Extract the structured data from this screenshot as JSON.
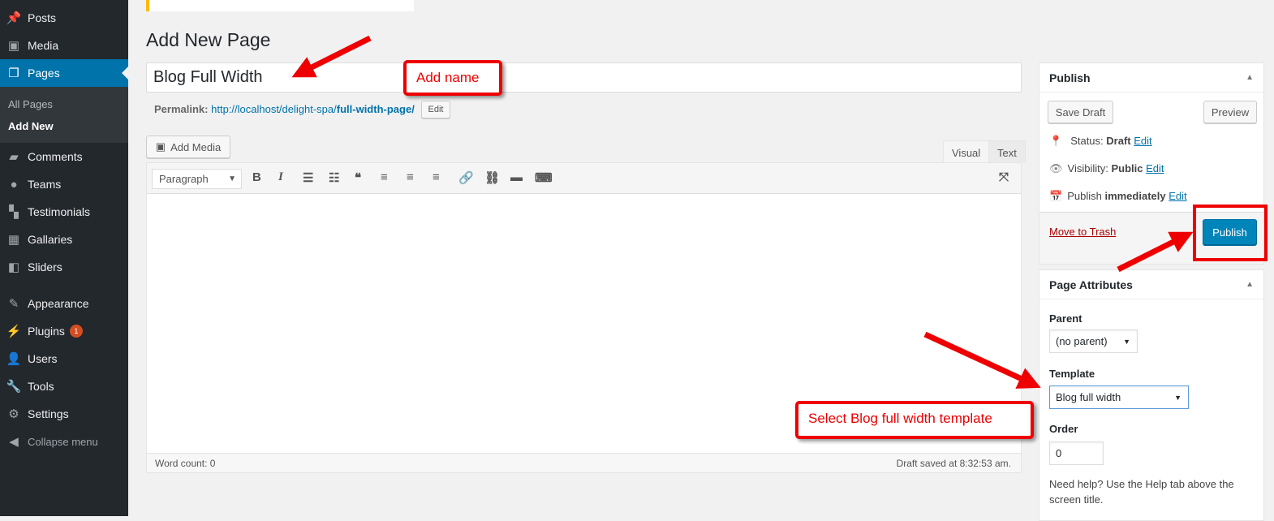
{
  "sidebar": {
    "items": [
      {
        "label": "Posts",
        "icon": "pin-icon"
      },
      {
        "label": "Media",
        "icon": "media-icon"
      },
      {
        "label": "Pages",
        "icon": "pages-icon",
        "active": true
      },
      {
        "label": "Comments",
        "icon": "comment-icon"
      },
      {
        "label": "Teams",
        "icon": "groups-icon"
      },
      {
        "label": "Testimonials",
        "icon": "testimonial-icon"
      },
      {
        "label": "Gallaries",
        "icon": "gallery-icon"
      },
      {
        "label": "Sliders",
        "icon": "slides-icon"
      },
      {
        "label": "Appearance",
        "icon": "brush-icon"
      },
      {
        "label": "Plugins",
        "icon": "plugin-icon",
        "badge": "1"
      },
      {
        "label": "Users",
        "icon": "user-icon"
      },
      {
        "label": "Tools",
        "icon": "wrench-icon"
      },
      {
        "label": "Settings",
        "icon": "settings-icon"
      },
      {
        "label": "Collapse menu",
        "icon": "collapse-icon"
      }
    ],
    "submenu": [
      "All Pages",
      "Add New"
    ]
  },
  "main": {
    "heading": "Add New Page",
    "title_value": "Blog Full Width",
    "permalink_label": "Permalink:",
    "permalink_base": "http://localhost/delight-spa/",
    "permalink_slug": "full-width-page/",
    "edit": "Edit",
    "add_media": "Add Media",
    "tabs": [
      "Visual",
      "Text"
    ],
    "format": "Paragraph",
    "word_count": "Word count: 0",
    "draft_saved": "Draft saved at 8:32:53 am."
  },
  "publish": {
    "title": "Publish",
    "save_draft": "Save Draft",
    "preview": "Preview",
    "status_label": "Status:",
    "status": "Draft",
    "visibility_label": "Visibility:",
    "visibility": "Public",
    "publish_label": "Publish",
    "publish_when": "immediately",
    "edit": "Edit",
    "trash": "Move to Trash",
    "publish_btn": "Publish"
  },
  "attributes": {
    "title": "Page Attributes",
    "parent_label": "Parent",
    "parent": "(no parent)",
    "template_label": "Template",
    "template": "Blog full width",
    "order_label": "Order",
    "order": "0",
    "help": "Need help? Use the Help tab above the screen title."
  },
  "annotations": {
    "name": "Add name",
    "template": "Select Blog full width template"
  },
  "colors": {
    "accent": "#0073aa",
    "annotation": "#ee0000",
    "sidebar": "#23282d"
  }
}
